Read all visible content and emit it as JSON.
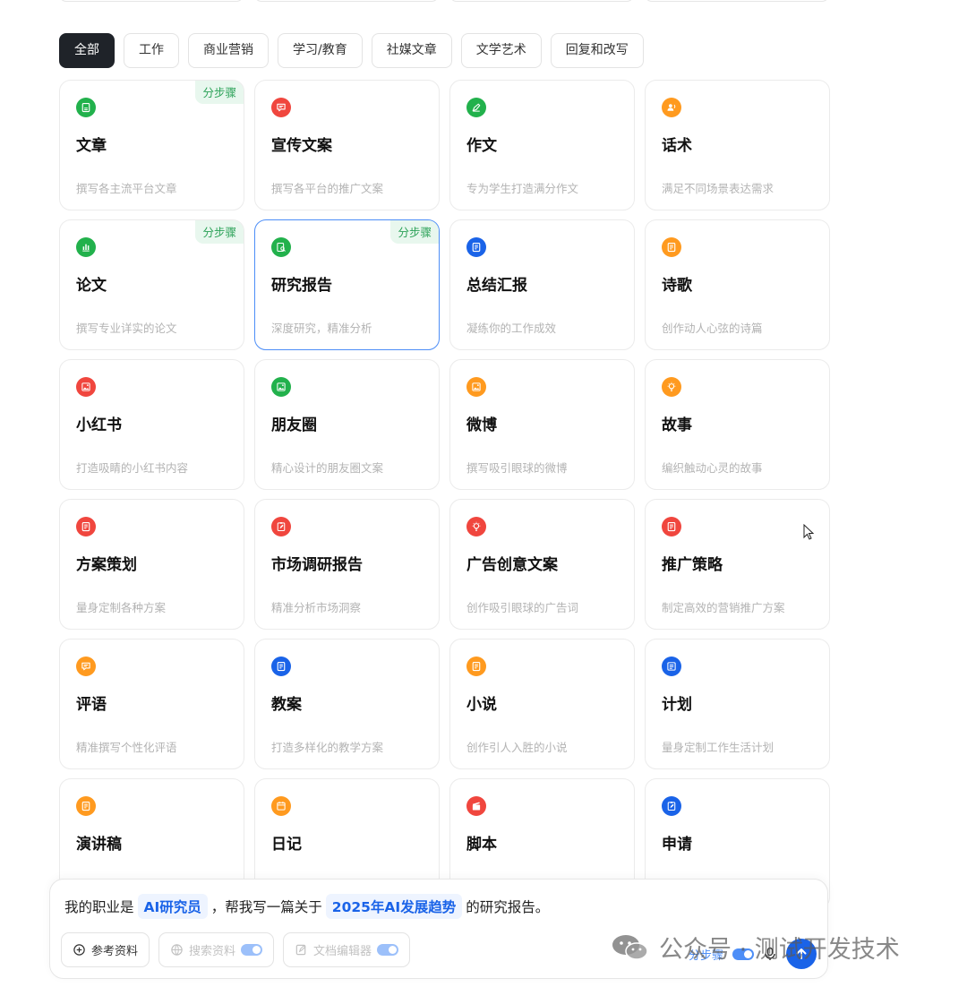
{
  "tabs": [
    "全部",
    "工作",
    "商业营销",
    "学习/教育",
    "社媒文章",
    "文学艺术",
    "回复和改写"
  ],
  "active_tab": 0,
  "badge_label": "分步骤",
  "cards": [
    {
      "title": "文章",
      "desc": "撰写各主流平台文章",
      "icon": "document-icon",
      "color": "#22b14c",
      "badge": true
    },
    {
      "title": "宣传文案",
      "desc": "撰写各平台的推广文案",
      "icon": "speech-bubble-icon",
      "color": "#f0463e",
      "badge": false
    },
    {
      "title": "作文",
      "desc": "专为学生打造满分作文",
      "icon": "pen-icon",
      "color": "#22b14c",
      "badge": false
    },
    {
      "title": "话术",
      "desc": "满足不同场景表达需求",
      "icon": "speaker-person-icon",
      "color": "#ff9a1f",
      "badge": false
    },
    {
      "title": "论文",
      "desc": "撰写专业详实的论文",
      "icon": "bar-chart-icon",
      "color": "#22b14c",
      "badge": true
    },
    {
      "title": "研究报告",
      "desc": "深度研究，精准分析",
      "icon": "search-document-icon",
      "color": "#22b14c",
      "badge": true,
      "selected": true
    },
    {
      "title": "总结汇报",
      "desc": "凝练你的工作成效",
      "icon": "notebook-icon",
      "color": "#1a63e8",
      "badge": false
    },
    {
      "title": "诗歌",
      "desc": "创作动人心弦的诗篇",
      "icon": "notebook-icon",
      "color": "#ff9a1f",
      "badge": false
    },
    {
      "title": "小红书",
      "desc": "打造吸睛的小红书内容",
      "icon": "image-icon",
      "color": "#f0463e",
      "badge": false
    },
    {
      "title": "朋友圈",
      "desc": "精心设计的朋友圈文案",
      "icon": "image-icon",
      "color": "#22b14c",
      "badge": false
    },
    {
      "title": "微博",
      "desc": "撰写吸引眼球的微博",
      "icon": "image-icon",
      "color": "#ff9a1f",
      "badge": false
    },
    {
      "title": "故事",
      "desc": "编织触动心灵的故事",
      "icon": "lightbulb-icon",
      "color": "#ff9a1f",
      "badge": false
    },
    {
      "title": "方案策划",
      "desc": "量身定制各种方案",
      "icon": "notebook-icon",
      "color": "#f0463e",
      "badge": false
    },
    {
      "title": "市场调研报告",
      "desc": "精准分析市场洞察",
      "icon": "clipboard-edit-icon",
      "color": "#f0463e",
      "badge": false
    },
    {
      "title": "广告创意文案",
      "desc": "创作吸引眼球的广告词",
      "icon": "lightbulb-icon",
      "color": "#f0463e",
      "badge": false
    },
    {
      "title": "推广策略",
      "desc": "制定高效的营销推广方案",
      "icon": "notebook-icon",
      "color": "#f0463e",
      "badge": false
    },
    {
      "title": "评语",
      "desc": "精准撰写个性化评语",
      "icon": "speech-bubble-icon",
      "color": "#ff9a1f",
      "badge": false
    },
    {
      "title": "教案",
      "desc": "打造多样化的教学方案",
      "icon": "notebook-icon",
      "color": "#1a63e8",
      "badge": false
    },
    {
      "title": "小说",
      "desc": "创作引人入胜的小说",
      "icon": "notebook-icon",
      "color": "#ff9a1f",
      "badge": false
    },
    {
      "title": "计划",
      "desc": "量身定制工作生活计划",
      "icon": "list-icon",
      "color": "#1a63e8",
      "badge": false
    },
    {
      "title": "演讲稿",
      "desc": "",
      "icon": "notebook-icon",
      "color": "#ff9a1f",
      "badge": false
    },
    {
      "title": "日记",
      "desc": "",
      "icon": "calendar-icon",
      "color": "#ff9a1f",
      "badge": false
    },
    {
      "title": "脚本",
      "desc": "",
      "icon": "clapperboard-icon",
      "color": "#f0463e",
      "badge": false
    },
    {
      "title": "申请",
      "desc": "",
      "icon": "clipboard-edit-icon",
      "color": "#1a63e8",
      "badge": false
    }
  ],
  "composer": {
    "prefix": "我的职业是",
    "slot1": "AI研究员",
    "middle": "，帮我写一篇关于",
    "slot2": "2025年AI发展趋势",
    "suffix": "的研究报告。",
    "tools": [
      {
        "label": "参考资料",
        "icon": "plus-circle-icon",
        "disabled": false,
        "toggle": false
      },
      {
        "label": "搜索资料",
        "icon": "globe-icon",
        "disabled": true,
        "toggle": true
      },
      {
        "label": "文档编辑器",
        "icon": "edit-icon",
        "disabled": true,
        "toggle": true
      }
    ],
    "step_label": "分步骤"
  },
  "watermark": "公众号 · 测试开发技术",
  "colors": {
    "accent": "#1a63e8",
    "green": "#22b14c",
    "red": "#f0463e",
    "orange": "#ff9a1f",
    "badge_bg": "#e8f7ee"
  }
}
